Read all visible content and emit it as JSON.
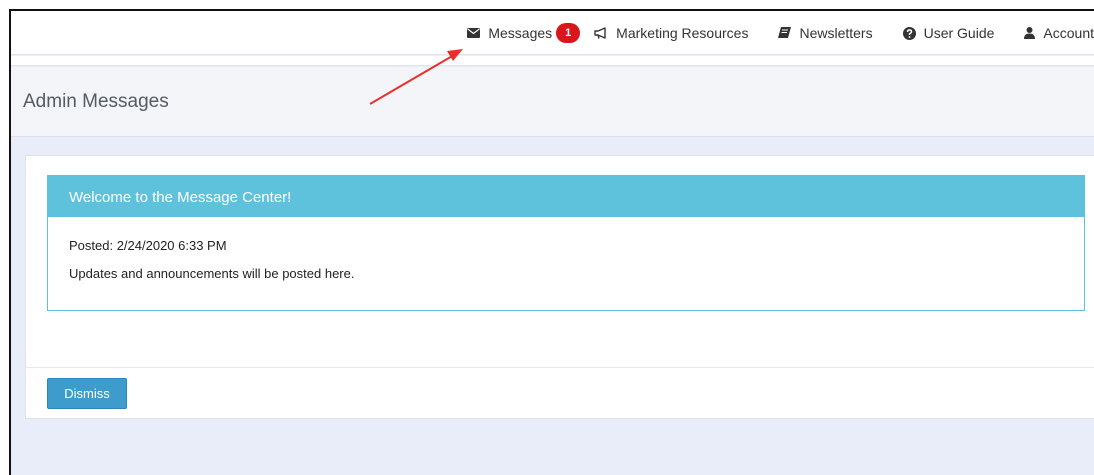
{
  "nav": {
    "messages_label": "Messages",
    "messages_count": "1",
    "marketing_label": "Marketing Resources",
    "newsletters_label": "Newsletters",
    "guide_label": "User Guide",
    "account_label": "Account"
  },
  "page": {
    "title": "Admin Messages"
  },
  "message": {
    "title": "Welcome to the Message Center!",
    "posted": "Posted: 2/24/2020 6:33 PM",
    "body": "Updates and announcements will be posted here."
  },
  "actions": {
    "dismiss_label": "Dismiss"
  },
  "colors": {
    "header_accent": "#5fc2dd",
    "badge": "#d9161c",
    "button": "#3d9ccb",
    "annotation_arrow": "#e8302c"
  },
  "icons": [
    "envelope-icon",
    "megaphone-icon",
    "book-icon",
    "question-circle-icon",
    "user-icon"
  ]
}
